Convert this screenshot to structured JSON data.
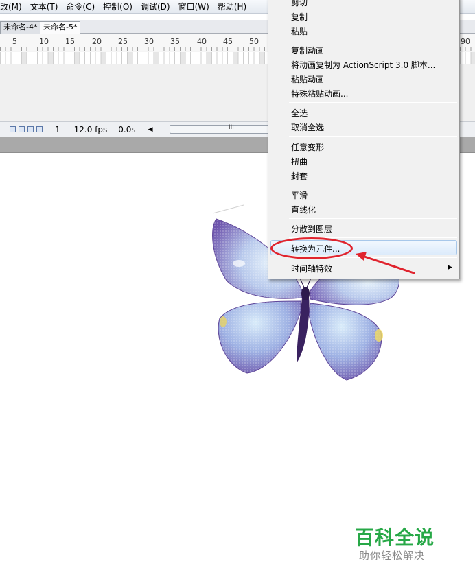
{
  "menubar": {
    "items": [
      "改(M)",
      "文本(T)",
      "命令(C)",
      "控制(O)",
      "调试(D)",
      "窗口(W)",
      "帮助(H)"
    ]
  },
  "tabs": [
    "未命名-4*",
    "未命名-5*"
  ],
  "timeline": {
    "ruler_numbers": [
      "5",
      "10",
      "15",
      "20",
      "25",
      "30",
      "35",
      "40",
      "45",
      "50",
      "90"
    ],
    "current_frame": "1",
    "frame_rate": "12.0 fps",
    "elapsed_time": "0.0s",
    "scroll_grip": "III"
  },
  "context_menu": {
    "items": {
      "cut": "剪切",
      "copy": "复制",
      "paste": "粘贴",
      "copy_motion": "复制动画",
      "copy_motion_as": "将动画复制为 ActionScript 3.0 脚本...",
      "paste_motion": "粘贴动画",
      "paste_motion_special": "特殊粘贴动画...",
      "select_all": "全选",
      "deselect_all": "取消全选",
      "free_transform": "任意变形",
      "distort": "扭曲",
      "envelope": "封套",
      "smooth": "平滑",
      "straighten": "直线化",
      "distribute_to_layers": "分散到图层",
      "convert_to_symbol": "转换为元件...",
      "timeline_effects": "时间轴特效"
    },
    "highlighted": "convert_to_symbol"
  },
  "watermark": {
    "title": "百科全说",
    "subtitle": "助你轻松解决"
  },
  "colors": {
    "annotation": "#e0242e",
    "watermark_green": "#27a847",
    "butterfly_purple": "#7f62b8",
    "butterfly_light": "#cfe4f7"
  }
}
